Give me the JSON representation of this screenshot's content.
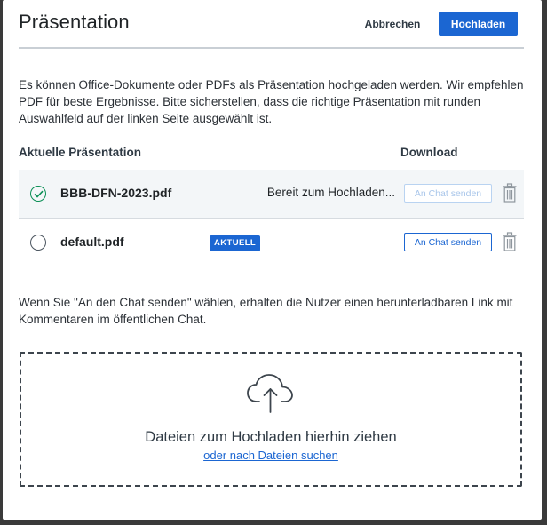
{
  "header": {
    "title": "Präsentation",
    "cancel_label": "Abbrechen",
    "upload_label": "Hochladen"
  },
  "intro": "Es können Office-Dokumente oder PDFs als Präsentation hochgeladen werden. Wir empfehlen PDF für beste Ergebnisse. Bitte sicherstellen, dass die richtige Präsentation mit runden Auswahlfeld auf der linken Seite ausgewählt ist.",
  "table": {
    "col_current": "Aktuelle Präsentation",
    "col_download": "Download",
    "rows": [
      {
        "selected": true,
        "filename": "BBB-DFN-2023.pdf",
        "status": "Bereit zum Hochladen...",
        "chat_label": "An Chat senden",
        "chat_enabled": false,
        "icon": "trash-icon"
      },
      {
        "selected": false,
        "filename": "default.pdf",
        "badge": "AKTUELL",
        "chat_label": "An Chat senden",
        "chat_enabled": true,
        "icon": "trash-icon"
      }
    ]
  },
  "note": "Wenn Sie \"An den Chat senden\" wählen, erhalten die Nutzer einen herunterladbaren Link mit Kommentaren im öffentlichen Chat.",
  "dropzone": {
    "icon": "cloud-upload-icon",
    "text": "Dateien zum Hochladen hierhin ziehen",
    "link": "oder nach Dateien suchen"
  },
  "colors": {
    "primary": "#1b66d2",
    "selected_check": "#0a8f55",
    "row_selected_bg": "#f3f6f8"
  }
}
